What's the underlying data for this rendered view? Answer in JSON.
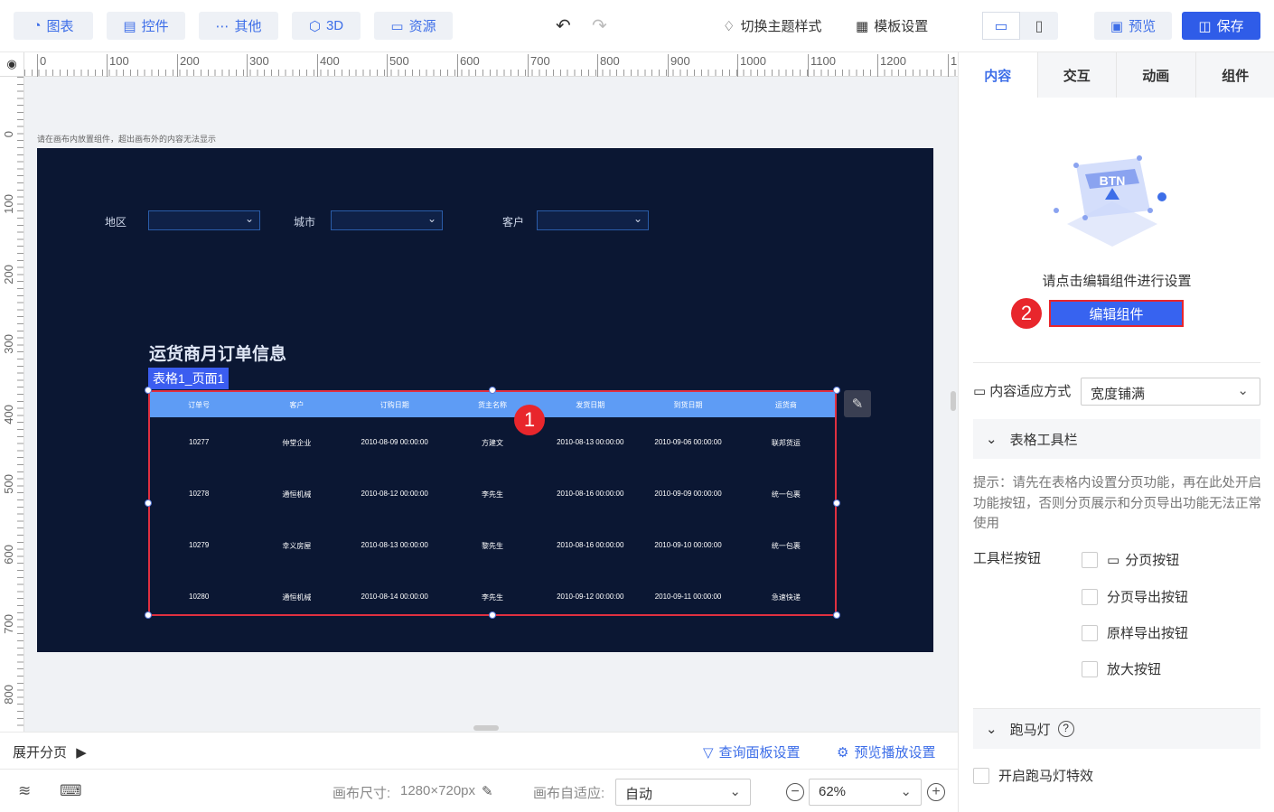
{
  "toolbar": {
    "chart": "图表",
    "widget": "控件",
    "other": "其他",
    "three_d": "3D",
    "resource": "资源",
    "switch_theme": "切换主题样式",
    "template_settings": "模板设置",
    "preview": "预览",
    "save": "保存"
  },
  "ruler": {
    "top_labels": [
      "0",
      "100",
      "200",
      "300",
      "400",
      "500",
      "600",
      "700",
      "800",
      "900",
      "1000",
      "1100",
      "1200",
      "1"
    ],
    "left_labels": [
      "0",
      "100",
      "200",
      "300",
      "400",
      "500",
      "600",
      "700",
      "800"
    ]
  },
  "canvas": {
    "hint": "请在画布内放置组件，超出画布外的内容无法显示"
  },
  "dashboard": {
    "filters": [
      {
        "label": "地区"
      },
      {
        "label": "城市"
      },
      {
        "label": "客户"
      }
    ],
    "title": "运货商月订单信息",
    "table_tag": "表格1_页面1",
    "columns": [
      "订单号",
      "客户",
      "订购日期",
      "货主名称",
      "发货日期",
      "到货日期",
      "运货商"
    ],
    "rows": [
      [
        "10277",
        "仲堂企业",
        "2010-08-09 00:00:00",
        "方建文",
        "2010-08-13 00:00:00",
        "2010-09-06 00:00:00",
        "联邦货运"
      ],
      [
        "10278",
        "通恒机械",
        "2010-08-12 00:00:00",
        "李先生",
        "2010-08-16 00:00:00",
        "2010-09-09 00:00:00",
        "统一包裹"
      ],
      [
        "10279",
        "幸义房屋",
        "2010-08-13 00:00:00",
        "黎先生",
        "2010-08-16 00:00:00",
        "2010-09-10 00:00:00",
        "统一包裹"
      ],
      [
        "10280",
        "通恒机械",
        "2010-08-14 00:00:00",
        "李先生",
        "2010-09-12 00:00:00",
        "2010-09-11 00:00:00",
        "急速快递"
      ]
    ]
  },
  "markers": {
    "one": "1",
    "two": "2"
  },
  "page_bar": {
    "expand_pages": "展开分页",
    "query_panel": "查询面板设置",
    "preview_play": "预览播放设置"
  },
  "status_bar": {
    "canvas_size_label": "画布尺寸:",
    "canvas_size_value": "1280×720px",
    "canvas_fit_label": "画布自适应:",
    "canvas_fit_value": "自动",
    "zoom_value": "62%"
  },
  "right_panel": {
    "tabs": [
      "内容",
      "交互",
      "动画",
      "组件"
    ],
    "illustration_text": "BTN",
    "edit_hint": "请点击编辑组件进行设置",
    "edit_button": "编辑组件",
    "fit_label": "内容适应方式",
    "fit_value": "宽度铺满",
    "table_toolbar_title": "表格工具栏",
    "tip": "提示：请先在表格内设置分页功能，再在此处开启功能按钮，否则分页展示和分页导出功能无法正常使用",
    "toolbar_buttons_label": "工具栏按钮",
    "checkboxes": [
      "分页按钮",
      "分页导出按钮",
      "原样导出按钮",
      "放大按钮"
    ],
    "marquee_title": "跑马灯",
    "marquee_enable": "开启跑马灯特效"
  },
  "colors": {
    "accent": "#3d6ee8",
    "dashboard_bg": "#0b1733",
    "table_header": "#5e9cf5",
    "selection": "#e03040",
    "marker": "#e8262c"
  }
}
